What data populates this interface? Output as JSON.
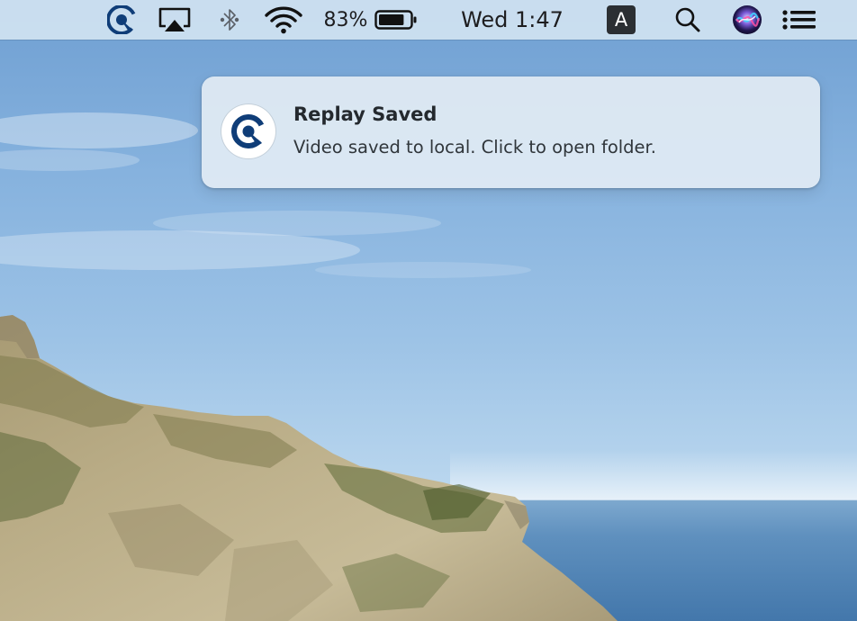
{
  "menubar": {
    "app_icon": "replay-app-icon",
    "airplay_icon": "airplay-icon",
    "bluetooth_icon": "bluetooth-icon",
    "wifi_icon": "wifi-icon",
    "battery": {
      "percent_label": "83%",
      "level": 0.83,
      "icon": "battery-icon"
    },
    "clock": "Wed 1:47",
    "input_source": "A",
    "search_icon": "search-icon",
    "siri_icon": "siri-icon",
    "notification_center_icon": "notification-center-icon"
  },
  "notification": {
    "icon": "replay-app-icon",
    "title": "Replay Saved",
    "body": "Video saved to local. Click to open folder."
  },
  "colors": {
    "brand_blue": "#0f3d78",
    "menubar_bg": "#d0e2f1",
    "notification_bg": "#e2ecf4",
    "title_text": "#24292e",
    "body_text": "#30363b"
  }
}
